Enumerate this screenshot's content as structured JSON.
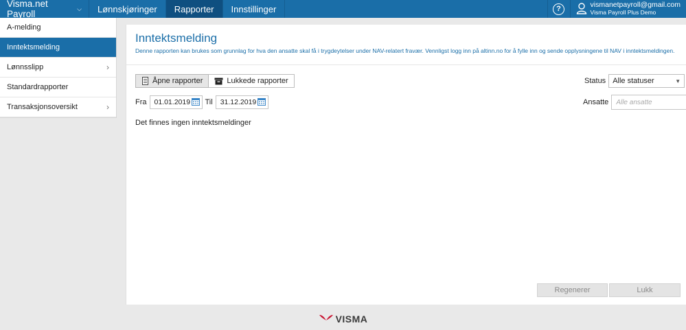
{
  "topbar": {
    "app_title": "Visma.net Payroll",
    "nav": [
      "Lønnskjøringer",
      "Rapporter",
      "Innstillinger"
    ],
    "active_nav": "Rapporter",
    "help_label": "?",
    "user_email": "vismanetpayroll@gmail.com",
    "user_org": "Visma Payroll Plus Demo",
    "colors": {
      "bar": "#1a6ea8",
      "active": "#0f4f80"
    }
  },
  "sidebar": {
    "items": [
      {
        "label": "A-melding",
        "chevron": false
      },
      {
        "label": "Inntektsmelding",
        "chevron": false,
        "active": true
      },
      {
        "label": "Lønnsslipp",
        "chevron": true
      },
      {
        "label": "Standardrapporter",
        "chevron": false
      },
      {
        "label": "Transaksjonsoversikt",
        "chevron": true
      }
    ]
  },
  "main": {
    "title": "Inntektsmelding",
    "description": "Denne rapporten kan brukes som grunnlag for hva den ansatte skal få i trygdeytelser under NAV-relatert fravær. Vennligst logg inn på altinn.no for å fylle inn og sende opplysningene til NAV i inntektsmeldingen.",
    "toggle": {
      "open_label": "Åpne rapporter",
      "closed_label": "Lukkede rapporter"
    },
    "from_label": "Fra",
    "from_date": "01.01.2019",
    "to_label": "Til",
    "to_date": "31.12.2019",
    "empty_message": "Det finnes ingen inntektsmeldinger",
    "status_label": "Status",
    "status_value": "Alle statuser",
    "employees_label": "Ansatte",
    "employees_placeholder": "Alle ansatte",
    "regen_label": "Regenerer",
    "close_label": "Lukk"
  },
  "footer": {
    "logo_text": "VISMA",
    "logo_color": "#c8102e"
  }
}
